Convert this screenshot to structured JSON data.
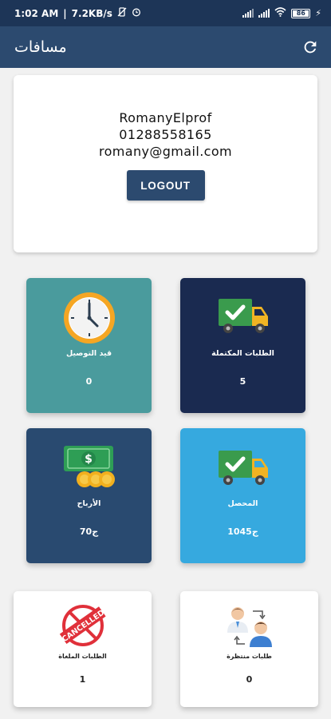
{
  "status_bar": {
    "time": "1:02 AM",
    "speed": "7.2KB/s",
    "separator": "|",
    "battery": "86",
    "vibrate_icon": "vibrate-off-icon",
    "alarm_icon": "alarm-icon"
  },
  "app_bar": {
    "title": "مسافات",
    "refresh_icon": "refresh-icon"
  },
  "profile": {
    "name": "RomanyElprof",
    "phone": "01288558165",
    "email": "romany@gmail.com",
    "logout_label": "LOGOUT"
  },
  "tiles": {
    "in_delivery": {
      "label": "قيد التوصيل",
      "value": "0",
      "color": "#4a9b9d",
      "icon": "clock-icon"
    },
    "completed": {
      "label": "الطلبات المكتملة",
      "value": "5",
      "color": "#1a2a50",
      "icon": "truck-check-icon"
    },
    "profits": {
      "label": "الأرباح",
      "value": "70ج",
      "color": "#294a70",
      "icon": "money-icon"
    },
    "collected": {
      "label": "المحصل",
      "value": "1045ج",
      "color": "#36a9df",
      "icon": "truck-check-icon"
    },
    "cancelled": {
      "label": "الطلبات الملغاة",
      "value": "1",
      "icon": "cancelled-stamp-icon",
      "stamp_text": "CANCELLED"
    },
    "pending": {
      "label": "طلبات منتظرة",
      "value": "0",
      "icon": "users-exchange-icon"
    }
  }
}
